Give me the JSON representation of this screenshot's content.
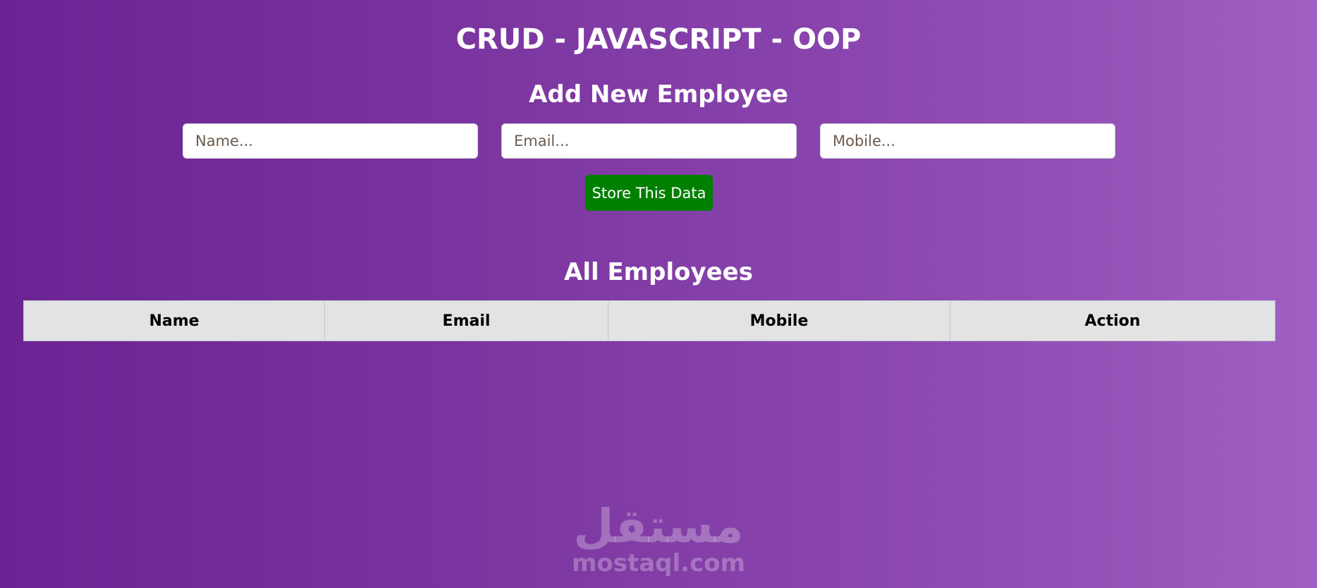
{
  "header": {
    "title": "CRUD - JAVASCRIPT - OOP"
  },
  "form": {
    "title": "Add New Employee",
    "name_placeholder": "Name...",
    "email_placeholder": "Email...",
    "mobile_placeholder": "Mobile...",
    "name_value": "",
    "email_value": "",
    "mobile_value": "",
    "submit_label": "Store This Data"
  },
  "employees": {
    "title": "All Employees",
    "columns": [
      "Name",
      "Email",
      "Mobile",
      "Action"
    ],
    "rows": []
  },
  "watermark": {
    "arabic": "مستقل",
    "domain": "mostaql.com"
  },
  "colors": {
    "submit_button": "#008000",
    "table_header_bg": "#e2e3e5"
  }
}
